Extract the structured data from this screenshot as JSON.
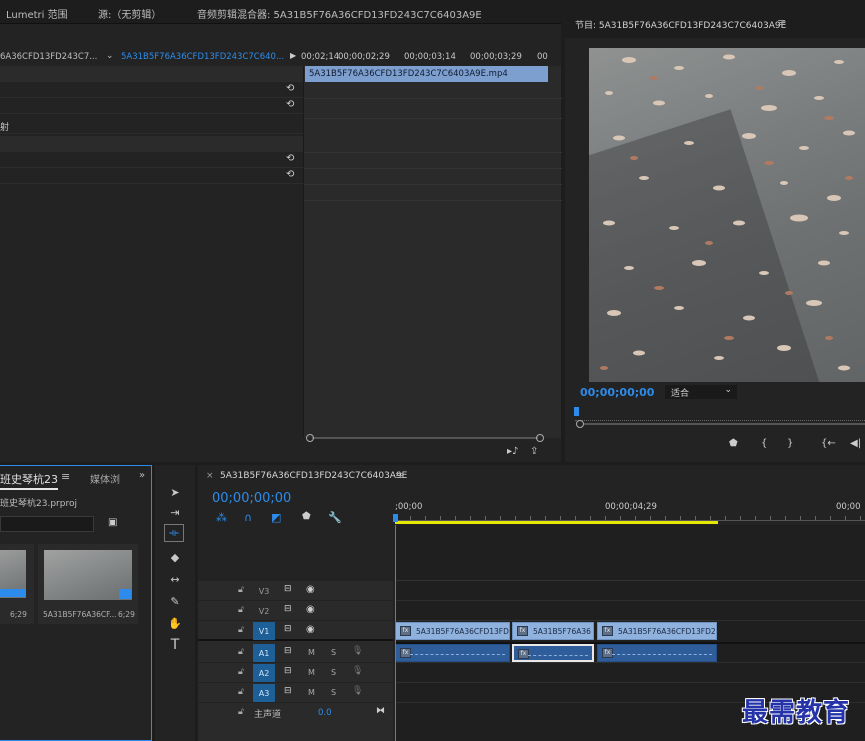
{
  "top_tabs": {
    "lumetri": "Lumetri 范围",
    "source": "源:（无剪辑）",
    "audio_mixer": "音频剪辑混合器: 5A31B5F76A36CFD13FD243C7C6403A9E"
  },
  "effect_controls": {
    "master_clip": "6A36CFD13FD243C7...",
    "sequence_clip": "5A31B5F76A36CFD13FD243C7C640...",
    "ruler": [
      "00;02;14",
      "00;00;02;29",
      "00;00;03;14",
      "00;00;03;29",
      "00"
    ],
    "clip_bar": "5A31B5F76A36CFD13FD243C7C6403A9E.mp4",
    "row_label": "射"
  },
  "program": {
    "title": "节目: 5A31B5F76A36CFD13FD243C7C6403A9E",
    "timecode": "00;00;00;00",
    "fit": "适合",
    "transport": [
      "{",
      "}",
      "{←",
      "◀|"
    ]
  },
  "project": {
    "tab_project": "班史琴杭23",
    "tab_media": "媒体浏",
    "file": "班史琴杭23.prproj",
    "items": [
      {
        "name": "",
        "duration": "6;29"
      },
      {
        "name": "5A31B5F76A36CF...",
        "duration": "6;29"
      }
    ]
  },
  "tools": [
    "selection-tool",
    "track-select-tool",
    "ripple-edit-tool",
    "razor-tool",
    "slip-tool",
    "pen-tool",
    "hand-tool",
    "type-tool"
  ],
  "timeline": {
    "sequence_tab": "5A31B5F76A36CFD13FD243C7C6403A9E",
    "timecode": "00;00;00;00",
    "ruler": [
      ";00;00",
      "00;00;04;29",
      "00;00"
    ],
    "video_tracks": [
      "V3",
      "V2",
      "V1"
    ],
    "audio_tracks": [
      "A1",
      "A2",
      "A3"
    ],
    "mute": "M",
    "solo": "S",
    "master": "主声道",
    "master_value": "0.0",
    "clips": {
      "v1_a": "5A31B5F76A36CFD13FD2",
      "v1_b": "5A31B5F76A36",
      "v1_c": "5A31B5F76A36CFD13FD24"
    }
  },
  "watermark": "最需教育",
  "colors": {
    "accent": "#2d8ceb",
    "clip_video": "#8fb1dd",
    "clip_audio": "#2e5d9a",
    "playhead_zone": "#e6e600"
  }
}
